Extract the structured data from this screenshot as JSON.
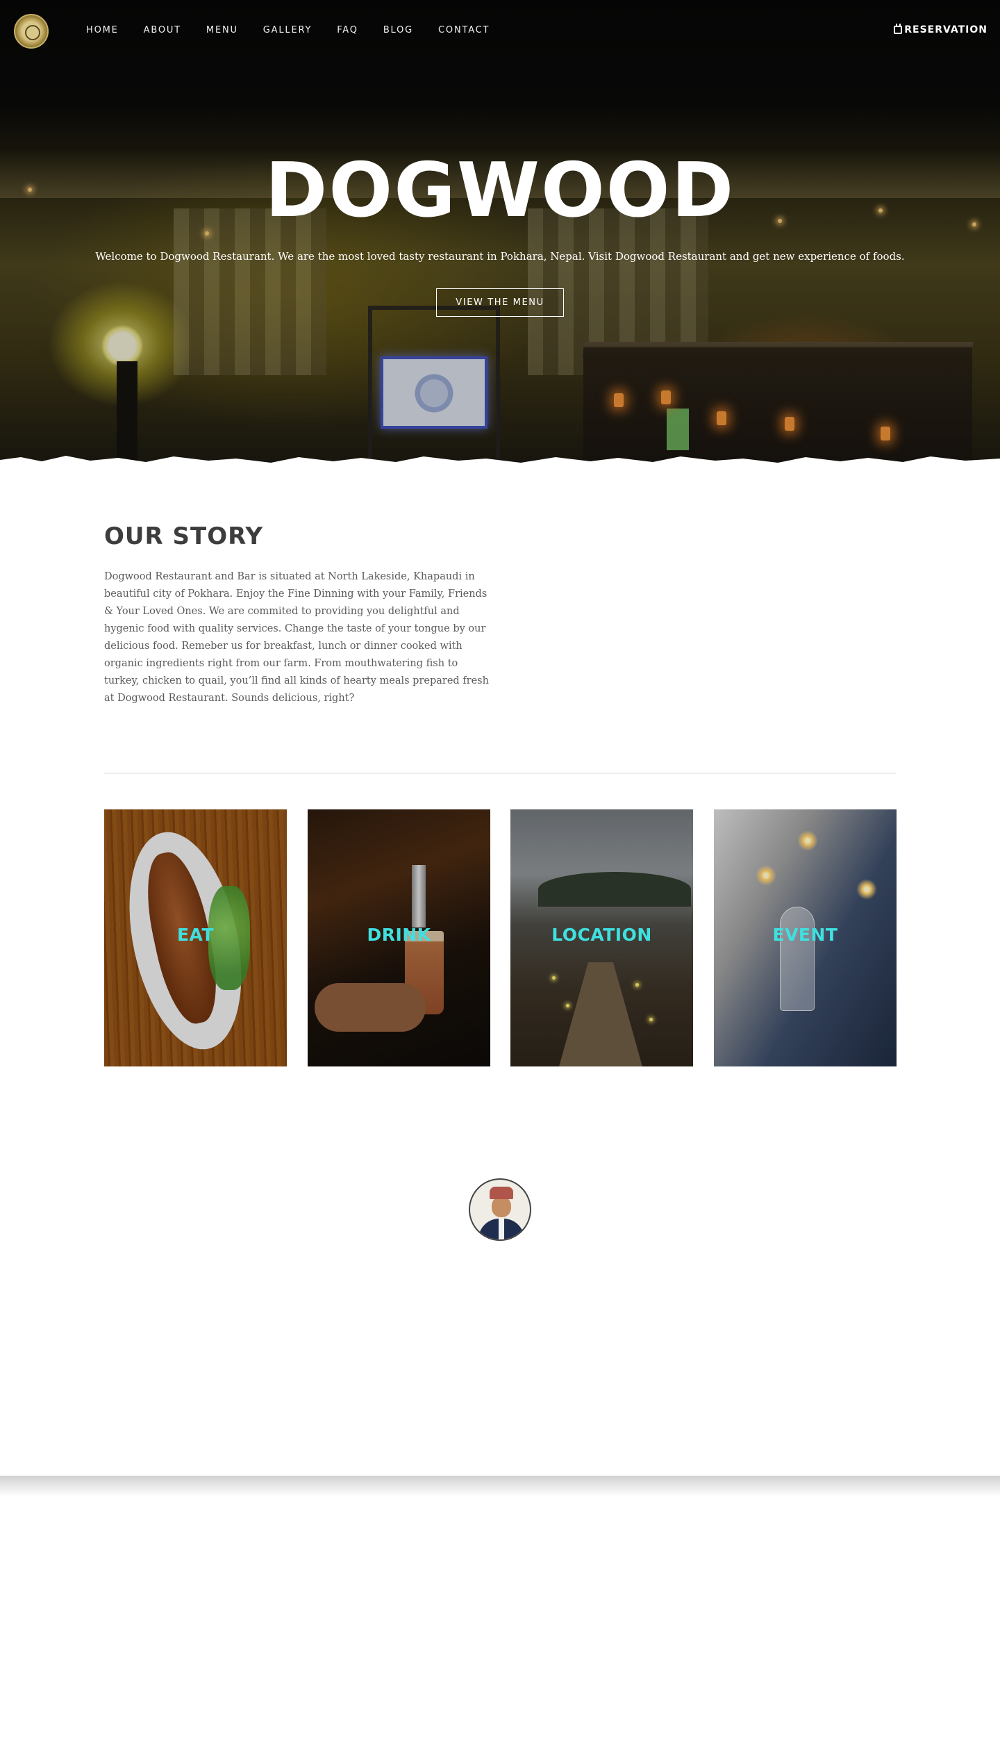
{
  "nav": {
    "links": [
      "HOME",
      "ABOUT",
      "MENU",
      "GALLERY",
      "FAQ",
      "BLOG",
      "CONTACT"
    ],
    "reservation_label": "RESERVATION",
    "logo_icon": "dogwood-logo-icon",
    "reservation_icon": "calendar-icon"
  },
  "hero": {
    "title": "DOGWOOD",
    "subtitle": "Welcome to Dogwood Restaurant. We are the most loved tasty restaurant in Pokhara, Nepal. Visit Dogwood Restaurant and get new experience of foods.",
    "button_label": "VIEW THE MENU"
  },
  "story": {
    "title": "OUR STORY",
    "text": "Dogwood Restaurant and Bar is situated at North Lakeside, Khapaudi in beautiful city of Pokhara. Enjoy the Fine Dinning with your Family, Friends & Your Loved Ones. We are commited to providing you delightful and hygenic food with quality services. Change the taste of your tongue by our delicious food. Remeber us for breakfast, lunch or dinner cooked with organic ingredients right from our farm. From mouthwatering fish to turkey, chicken to quail, you’ll find all kinds of hearty meals prepared fresh at Dogwood Restaurant. Sounds delicious, right?"
  },
  "cards": [
    {
      "label": "EAT"
    },
    {
      "label": "DRINK"
    },
    {
      "label": "LOCATION"
    },
    {
      "label": "EVENT"
    }
  ],
  "testimonial": {
    "text": "",
    "name": "",
    "role": ""
  },
  "colors": {
    "card_label": "#3fe0e0",
    "nav_text": "#f2f2f2",
    "story_title": "#3d3d3d"
  }
}
